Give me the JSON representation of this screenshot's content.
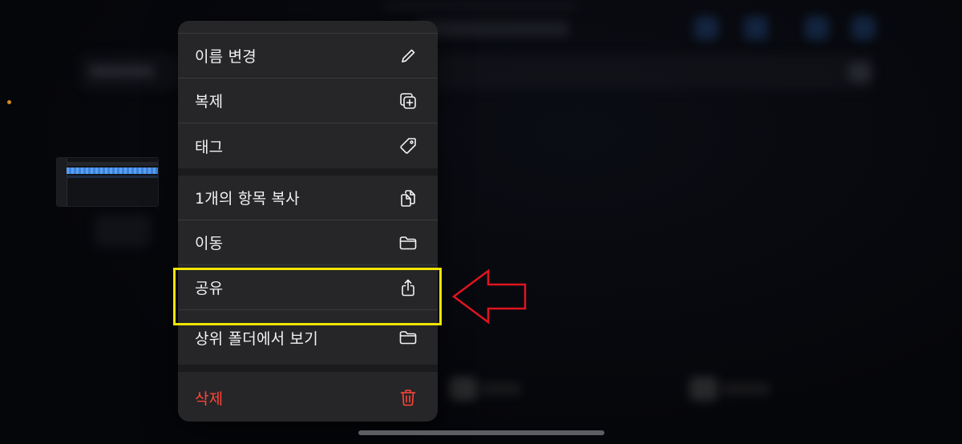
{
  "context_menu": {
    "items": [
      {
        "label": "이름 변경",
        "icon": "pencil-icon"
      },
      {
        "label": "복제",
        "icon": "duplicate-icon"
      },
      {
        "label": "태그",
        "icon": "tag-icon"
      },
      {
        "label": "1개의 항목 복사",
        "icon": "copy-documents-icon"
      },
      {
        "label": "이동",
        "icon": "folder-icon"
      },
      {
        "label": "공유",
        "icon": "share-icon"
      },
      {
        "label": "상위 폴더에서 보기",
        "icon": "folder-icon"
      },
      {
        "label": "삭제",
        "icon": "trash-icon"
      }
    ]
  },
  "annotation": {
    "highlighted_item": "공유",
    "highlight_color": "#f2e500",
    "arrow_color": "#e0141e"
  },
  "colors": {
    "menu_background": "#262628",
    "destructive": "#ff453a",
    "status_dot": "#d88a1a"
  }
}
